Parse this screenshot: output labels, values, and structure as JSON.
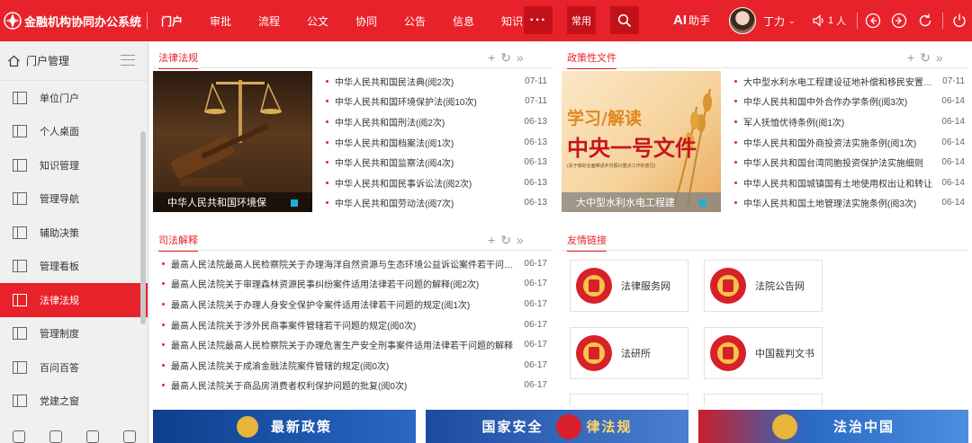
{
  "app": {
    "title": "金融机构协同办公系统"
  },
  "nav": {
    "items": [
      "门户",
      "审批",
      "流程",
      "公文",
      "协同",
      "公告",
      "信息",
      "知识"
    ],
    "more": "···",
    "common": "常用"
  },
  "header": {
    "ai_prefix": "AI",
    "ai_label": "助手",
    "user_name": "丁力",
    "online_count": "1",
    "online_unit": "人"
  },
  "sidebar": {
    "title": "门户管理",
    "items": [
      "单位门户",
      "个人桌面",
      "知识管理",
      "管理导航",
      "辅助决策",
      "管理看板",
      "法律法规",
      "管理制度",
      "百问百答",
      "党建之窗"
    ],
    "active_index": 6
  },
  "panels": {
    "law": {
      "title": "法律法规",
      "image_caption": "中华人民共和国环境保",
      "rows": [
        {
          "title": "中华人民共和国民法典(阅2次)",
          "date": "07-11"
        },
        {
          "title": "中华人民共和国环境保护法(阅10次)",
          "date": "07-11"
        },
        {
          "title": "中华人民共和国刑法(阅2次)",
          "date": "06-13"
        },
        {
          "title": "中华人民共和国档案法(阅1次)",
          "date": "06-13"
        },
        {
          "title": "中华人民共和国监察法(阅4次)",
          "date": "06-13"
        },
        {
          "title": "中华人民共和国民事诉讼法(阅2次)",
          "date": "06-13"
        },
        {
          "title": "中华人民共和国劳动法(阅7次)",
          "date": "06-13"
        }
      ]
    },
    "policy": {
      "title": "政策性文件",
      "image_line1": "学习/解读",
      "image_line2": "中央一号文件",
      "image_small": "(关于做好全面推进乡村振兴重点工作的意见)",
      "image_caption": "大中型水利水电工程建",
      "rows": [
        {
          "title": "大中型水利水电工程建设征地补偿和移民安置条例",
          "date": "07-11"
        },
        {
          "title": "中华人民共和国中外合作办学条例(阅3次)",
          "date": "06-14"
        },
        {
          "title": "军人抚恤优待条例(阅1次)",
          "date": "06-14"
        },
        {
          "title": "中华人民共和国外商投资法实施条例(阅1次)",
          "date": "06-14"
        },
        {
          "title": "中华人民共和国台湾同胞投资保护法实施细则",
          "date": "06-14"
        },
        {
          "title": "中华人民共和国城镇国有土地使用权出让和转让",
          "date": "06-14"
        },
        {
          "title": "中华人民共和国土地管理法实施条例(阅3次)",
          "date": "06-14"
        }
      ]
    },
    "judicial": {
      "title": "司法解释",
      "rows": [
        {
          "title": "最高人民法院最高人民检察院关于办理海洋自然资源与生态环境公益诉讼案件若干问题的规定",
          "date": "06-17"
        },
        {
          "title": "最高人民法院关于审理森林资源民事纠纷案件适用法律若干问题的解释(阅2次)",
          "date": "06-17"
        },
        {
          "title": "最高人民法院关于办理人身安全保护令案件适用法律若干问题的规定(阅1次)",
          "date": "06-17"
        },
        {
          "title": "最高人民法院关于涉外民商事案件管辖若干问题的规定(阅0次)",
          "date": "06-17"
        },
        {
          "title": "最高人民法院最高人民检察院关于办理危害生产安全刑事案件适用法律若干问题的解释",
          "date": "06-17"
        },
        {
          "title": "最高人民法院关于成渝金融法院案件管辖的规定(阅0次)",
          "date": "06-17"
        },
        {
          "title": "最高人民法院关于商品房消费者权利保护问题的批复(阅0次)",
          "date": "06-17"
        }
      ]
    },
    "links": {
      "title": "友情链接",
      "items": [
        "法律服务网",
        "法院公告网",
        "法研所",
        "中国裁判文书"
      ]
    }
  },
  "banners": [
    "最新政策",
    "国家安全",
    "律法规",
    "法治中国"
  ],
  "colors": {
    "brand": "#e8222a",
    "brand_dark": "#c3111a"
  }
}
